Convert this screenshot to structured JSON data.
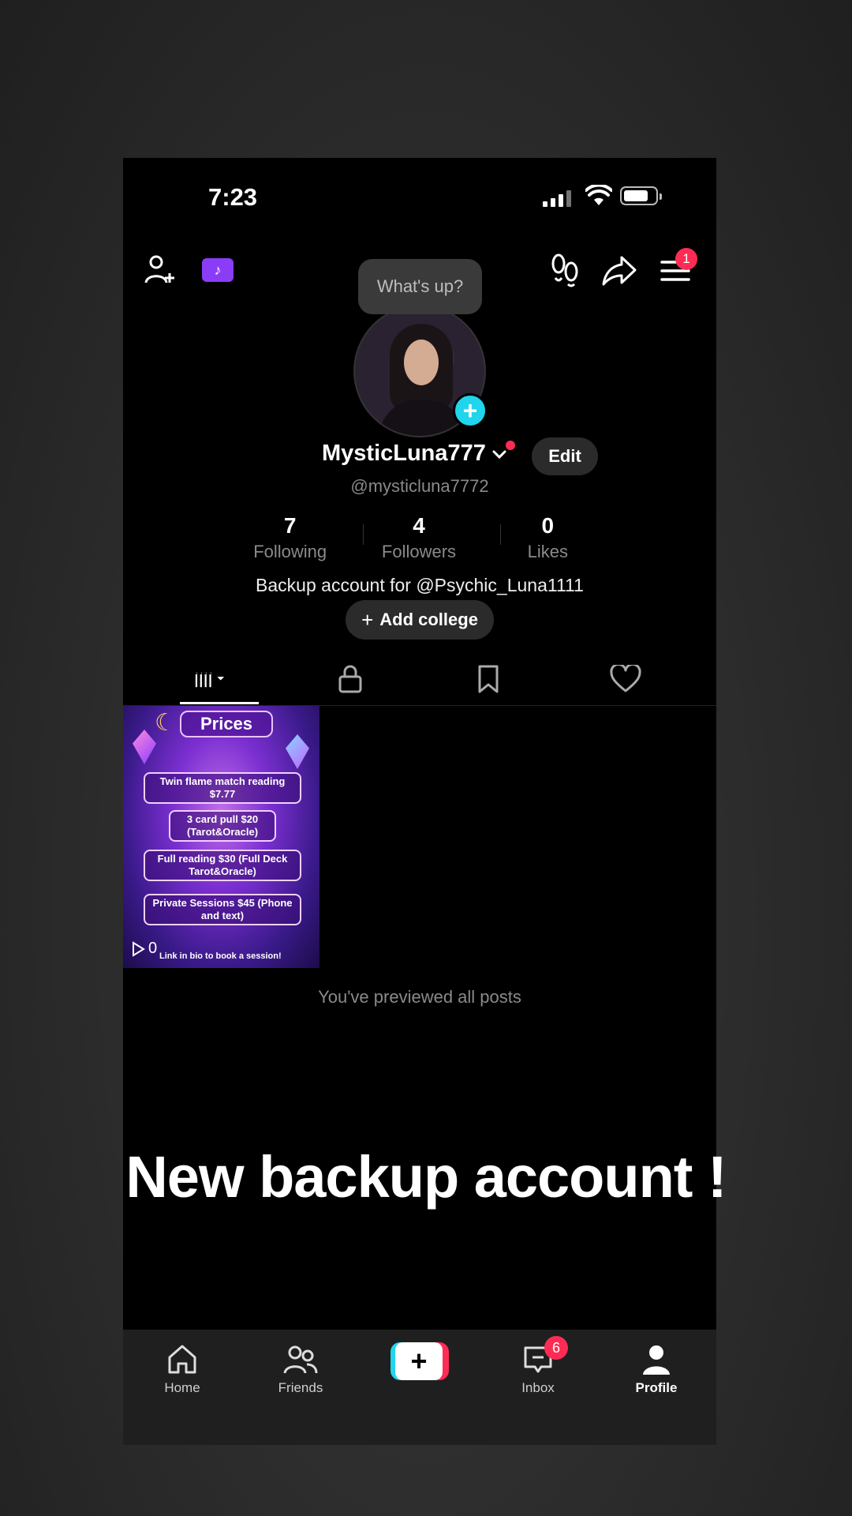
{
  "status_bar": {
    "time": "7:23"
  },
  "top_bar": {
    "icons": [
      "add-friend-icon",
      "tiktok-ticket-icon",
      "footprint-icon",
      "share-icon",
      "menu-icon"
    ],
    "menu_badge": "1",
    "bubble": "What's up?"
  },
  "profile": {
    "display_name": "MysticLuna777",
    "edit_label": "Edit",
    "handle": "@mysticluna7772",
    "stats": [
      {
        "value": "7",
        "label": "Following"
      },
      {
        "value": "4",
        "label": "Followers"
      },
      {
        "value": "0",
        "label": "Likes"
      }
    ],
    "bio": "Backup account for @Psychic_Luna1111",
    "add_college": "Add college"
  },
  "tabs": [
    "videos-tab",
    "private-tab",
    "saved-tab",
    "liked-tab"
  ],
  "post": {
    "title": "Prices",
    "lines": [
      "Twin flame match reading $7.77",
      "3 card pull $20 (Tarot&Oracle)",
      "Full reading $30 (Full Deck Tarot&Oracle)",
      "Private Sessions $45 (Phone and text)"
    ],
    "footer": "Link in bio to book a session!",
    "views": "0"
  },
  "previewed_text": "You've previewed all posts",
  "overlay_caption": "New backup account !",
  "bottom_nav": {
    "items": [
      {
        "label": "Home"
      },
      {
        "label": "Friends"
      },
      {
        "label": "Inbox"
      },
      {
        "label": "Profile"
      }
    ],
    "inbox_badge": "6"
  },
  "colors": {
    "accent_pink": "#fe2c55",
    "accent_cyan": "#20d5ec",
    "ticket_purple": "#8b3cf7"
  }
}
